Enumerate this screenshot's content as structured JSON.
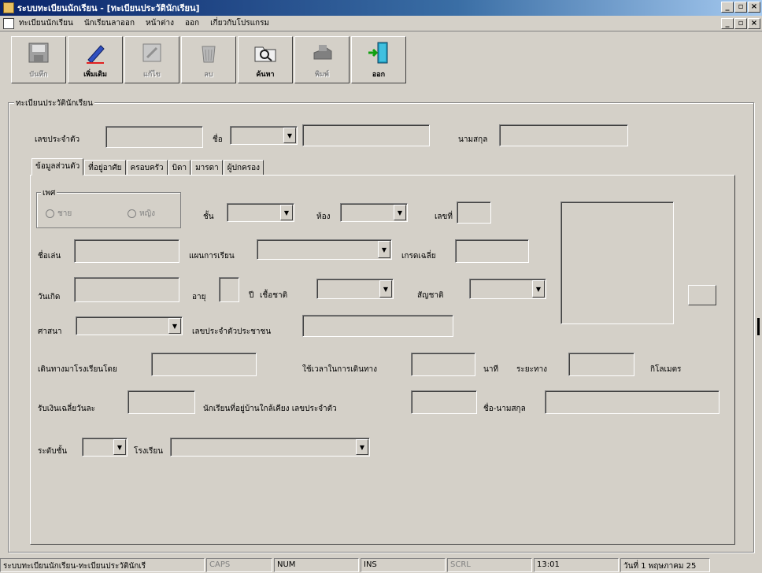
{
  "window": {
    "title": "ระบบทะเบียนนักเรียน - [ทะเบียนประวัตินักเรียน]"
  },
  "menu": [
    "ทะเบียนนักเรียน",
    "นักเรียนลาออก",
    "หน้าต่าง",
    "ออก",
    "เกี่ยวกับโปรแกรม"
  ],
  "toolbar": [
    {
      "label": "บันทึก",
      "icon": "save-icon",
      "enabled": false
    },
    {
      "label": "เพิ่มเติม",
      "icon": "add-pen-icon",
      "enabled": true
    },
    {
      "label": "แก้ไข",
      "icon": "edit-icon",
      "enabled": false
    },
    {
      "label": "ลบ",
      "icon": "trash-icon",
      "enabled": false
    },
    {
      "label": "ค้นหา",
      "icon": "search-folder-icon",
      "enabled": true
    },
    {
      "label": "พิมพ์",
      "icon": "print-icon",
      "enabled": false
    },
    {
      "label": "ออก",
      "icon": "exit-door-icon",
      "enabled": true
    }
  ],
  "group": {
    "title": "ทะเบียนประวัตินักเรียน",
    "id_label": "เลขประจำตัว",
    "name_label": "ชื่อ",
    "surname_label": "นามสกุล"
  },
  "tabs": [
    "ข้อมูลส่วนตัว",
    "ที่อยู่อาศัย",
    "ครอบครัว",
    "บิดา",
    "มารดา",
    "ผู้ปกครอง"
  ],
  "form": {
    "gender_label": "เพศ",
    "male": "ชาย",
    "female": "หญิง",
    "class_label": "ชั้น",
    "room_label": "ห้อง",
    "number_label": "เลขที่",
    "nickname_label": "ชื่อเล่น",
    "plan_label": "แผนการเรียน",
    "gpa_label": "เกรดเฉลี่ย",
    "birth_label": "วันเกิด",
    "age_label": "อายุ",
    "year_label": "ปี",
    "race_label": "เชื้อชาติ",
    "nationality_label": "สัญชาติ",
    "religion_label": "ศาสนา",
    "citizen_id_label": "เลขประจำตัวประชาชน",
    "travel_label": "เดินทางมาโรงเรียนโดย",
    "travel_time_label": "ใช้เวลาในการเดินทาง",
    "minutes_label": "นาที",
    "distance_label": "ระยะทาง",
    "km_label": "กิโลเมตร",
    "allowance_label": "รับเงินเฉลี่ยวันละ",
    "neighbor_label": "นักเรียนที่อยู่บ้านใกล้เคียง เลขประจำตัว",
    "neighbor_name_label": "ชื่อ-นามสกุล",
    "prev_level_label": "ระดับชั้น",
    "school_label": "โรงเรียน",
    "photo_button": ""
  },
  "status": {
    "text": "ระบบทะเบียนนักเรียน-ทะเบียนประวัตินักเรี",
    "caps": "CAPS",
    "num": "NUM",
    "ins": "INS",
    "scrl": "SCRL",
    "time": "13:01",
    "date": "วันที่ 1 พฤษภาคม 25"
  }
}
